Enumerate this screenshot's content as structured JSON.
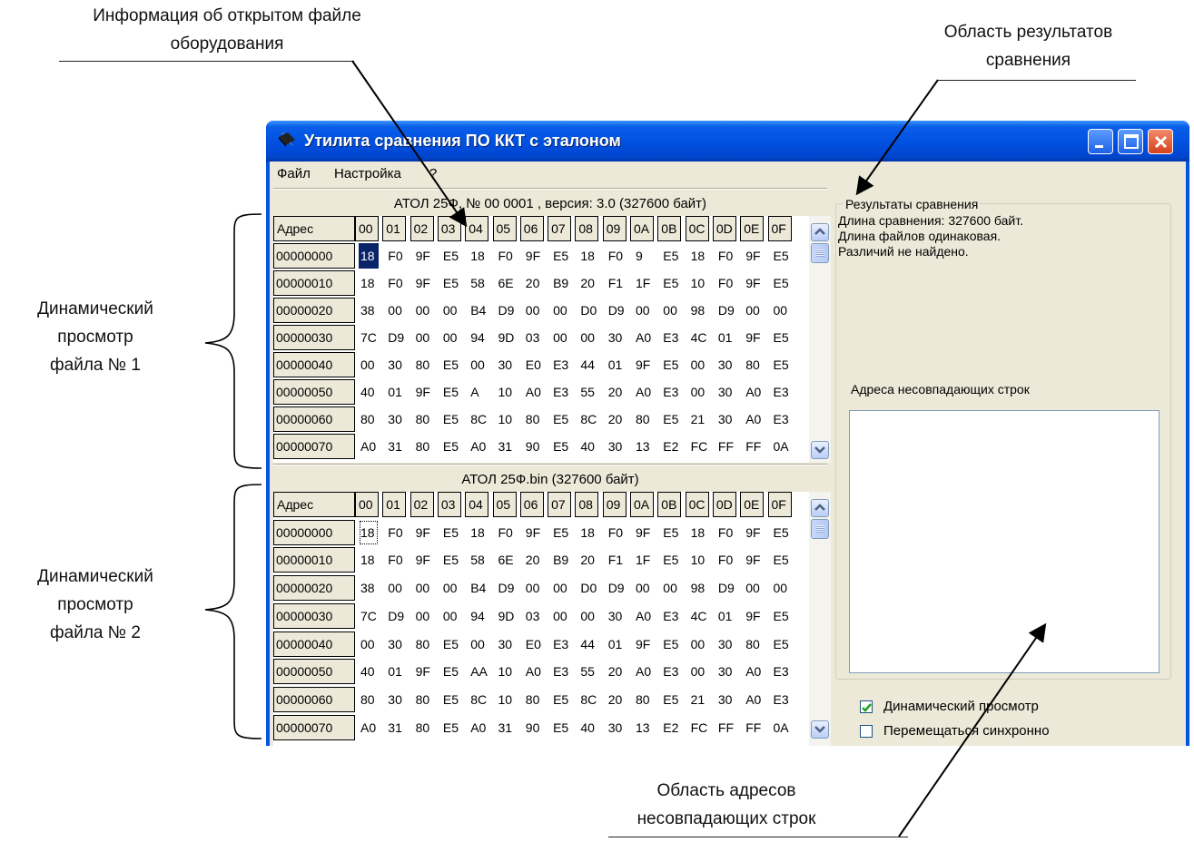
{
  "annotations": {
    "file_info_line1": "Информация об открытом файле",
    "file_info_line2": "оборудования",
    "results_line1": "Область результатов",
    "results_line2": "сравнения",
    "view1_line1": "Динамический",
    "view1_line2": "просмотр",
    "view1_line3": "файла № 1",
    "view2_line1": "Динамический",
    "view2_line2": "просмотр",
    "view2_line3": "файла № 2",
    "addresses_line1": "Область адресов",
    "addresses_line2": "несовпадающих строк"
  },
  "window": {
    "title": "Утилита сравнения ПО ККТ с эталоном"
  },
  "menu": {
    "file": "Файл",
    "settings": "Настройка",
    "help": "?"
  },
  "viewer1": {
    "file_info": "АТОЛ 25Ф, № 00 0001 , версия: 3.0 (327600 байт)"
  },
  "viewer2": {
    "file_info": "АТОЛ 25Ф.bin (327600 байт)"
  },
  "grid": {
    "address_header": "Адрес",
    "columns": [
      "00",
      "01",
      "02",
      "03",
      "04",
      "05",
      "06",
      "07",
      "08",
      "09",
      "0A",
      "0B",
      "0C",
      "0D",
      "0E",
      "0F"
    ],
    "addresses": [
      "00000000",
      "00000010",
      "00000020",
      "00000030",
      "00000040",
      "00000050",
      "00000060",
      "00000070"
    ]
  },
  "rows1": [
    [
      "18",
      "F0",
      "9F",
      "E5",
      "18",
      "F0",
      "9F",
      "E5",
      "18",
      "F0",
      "9",
      "E5",
      "18",
      "F0",
      "9F",
      "E5"
    ],
    [
      "18",
      "F0",
      "9F",
      "E5",
      "58",
      "6E",
      "20",
      "B9",
      "20",
      "F1",
      "1F",
      "E5",
      "10",
      "F0",
      "9F",
      "E5"
    ],
    [
      "38",
      "00",
      "00",
      "00",
      "B4",
      "D9",
      "00",
      "00",
      "D0",
      "D9",
      "00",
      "00",
      "98",
      "D9",
      "00",
      "00"
    ],
    [
      "7C",
      "D9",
      "00",
      "00",
      "94",
      "9D",
      "03",
      "00",
      "00",
      "30",
      "A0",
      "E3",
      "4C",
      "01",
      "9F",
      "E5"
    ],
    [
      "00",
      "30",
      "80",
      "E5",
      "00",
      "30",
      "E0",
      "E3",
      "44",
      "01",
      "9F",
      "E5",
      "00",
      "30",
      "80",
      "E5"
    ],
    [
      "40",
      "01",
      "9F",
      "E5",
      "A",
      "10",
      "A0",
      "E3",
      "55",
      "20",
      "A0",
      "E3",
      "00",
      "30",
      "A0",
      "E3"
    ],
    [
      "80",
      "30",
      "80",
      "E5",
      "8C",
      "10",
      "80",
      "E5",
      "8C",
      "20",
      "80",
      "E5",
      "21",
      "30",
      "A0",
      "E3"
    ],
    [
      "A0",
      "31",
      "80",
      "E5",
      "A0",
      "31",
      "90",
      "E5",
      "40",
      "30",
      "13",
      "E2",
      "FC",
      "FF",
      "FF",
      "0A"
    ]
  ],
  "rows2": [
    [
      "18",
      "F0",
      "9F",
      "E5",
      "18",
      "F0",
      "9F",
      "E5",
      "18",
      "F0",
      "9F",
      "E5",
      "18",
      "F0",
      "9F",
      "E5"
    ],
    [
      "18",
      "F0",
      "9F",
      "E5",
      "58",
      "6E",
      "20",
      "B9",
      "20",
      "F1",
      "1F",
      "E5",
      "10",
      "F0",
      "9F",
      "E5"
    ],
    [
      "38",
      "00",
      "00",
      "00",
      "B4",
      "D9",
      "00",
      "00",
      "D0",
      "D9",
      "00",
      "00",
      "98",
      "D9",
      "00",
      "00"
    ],
    [
      "7C",
      "D9",
      "00",
      "00",
      "94",
      "9D",
      "03",
      "00",
      "00",
      "30",
      "A0",
      "E3",
      "4C",
      "01",
      "9F",
      "E5"
    ],
    [
      "00",
      "30",
      "80",
      "E5",
      "00",
      "30",
      "E0",
      "E3",
      "44",
      "01",
      "9F",
      "E5",
      "00",
      "30",
      "80",
      "E5"
    ],
    [
      "40",
      "01",
      "9F",
      "E5",
      "AA",
      "10",
      "A0",
      "E3",
      "55",
      "20",
      "A0",
      "E3",
      "00",
      "30",
      "A0",
      "E3"
    ],
    [
      "80",
      "30",
      "80",
      "E5",
      "8C",
      "10",
      "80",
      "E5",
      "8C",
      "20",
      "80",
      "E5",
      "21",
      "30",
      "A0",
      "E3"
    ],
    [
      "A0",
      "31",
      "80",
      "E5",
      "A0",
      "31",
      "90",
      "E5",
      "40",
      "30",
      "13",
      "E2",
      "FC",
      "FF",
      "FF",
      "0A"
    ]
  ],
  "results": {
    "group_title": "Результаты сравнения",
    "line1": "Длина сравнения: 327600 байт.",
    "line2": "Длина файлов одинаковая.",
    "line3": "Различий не найдено.",
    "mismatch_label": "Адреса несовпадающих строк",
    "mismatch_addresses": []
  },
  "options": {
    "dynamic_view": {
      "label": "Динамический просмотр",
      "checked": true
    },
    "sync_scroll": {
      "label": "Перемещаться синхронно",
      "checked": false
    }
  },
  "colors": {
    "titlebar": "#0054e3",
    "selection": "#0a246a",
    "close_button": "#d6401b"
  }
}
